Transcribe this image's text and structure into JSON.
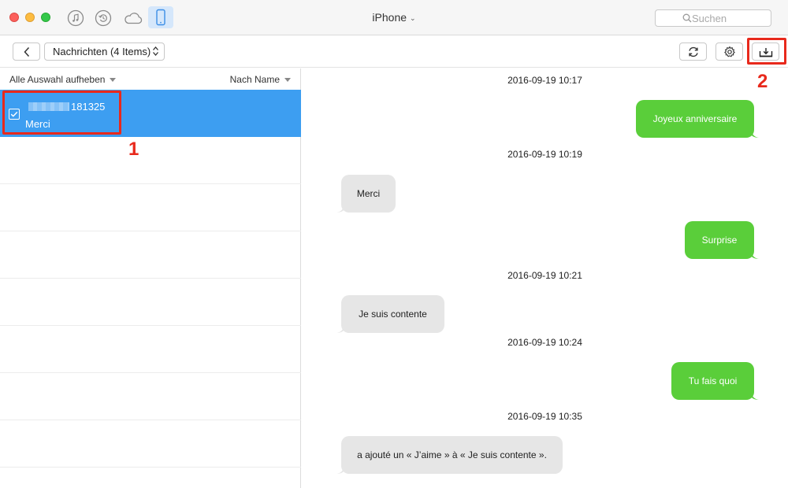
{
  "titlebar": {
    "device_name": "iPhone",
    "search_placeholder": "Suchen",
    "icons": [
      "music-note-icon",
      "restore-icon",
      "cloud-icon",
      "iphone-icon"
    ]
  },
  "toolbar": {
    "category_select": "Nachrichten (4 Items)",
    "icons": [
      "chevron-left-icon",
      "refresh-icon",
      "gear-icon",
      "export-to-computer-icon"
    ]
  },
  "list": {
    "deselect_all": "Alle Auswahl aufheben",
    "sort_by": "Nach Name",
    "items": [
      {
        "number": "181325",
        "preview": "Merci",
        "selected": true
      }
    ]
  },
  "annotations": {
    "step1": "1",
    "step2": "2"
  },
  "conversation": {
    "timestamps": [
      "2016-09-19 10:17",
      "2016-09-19 10:19",
      "2016-09-19 10:21",
      "2016-09-19 10:24",
      "2016-09-19 10:35"
    ],
    "messages": [
      {
        "text": "Joyeux anniversaire",
        "direction": "outgoing"
      },
      {
        "text": "Merci",
        "direction": "incoming"
      },
      {
        "text": "Surprise",
        "direction": "outgoing"
      },
      {
        "text": "Je suis contente",
        "direction": "incoming"
      },
      {
        "text": "Tu fais quoi",
        "direction": "outgoing"
      },
      {
        "text": "a ajouté un « J’aime » à « Je suis contente  ».",
        "direction": "incoming"
      }
    ]
  },
  "colors": {
    "selected_row": "#3d9ef1",
    "outgoing_bubble": "#5ace3a",
    "incoming_bubble": "#e6e6e6",
    "annotation_red": "#e8291c"
  }
}
